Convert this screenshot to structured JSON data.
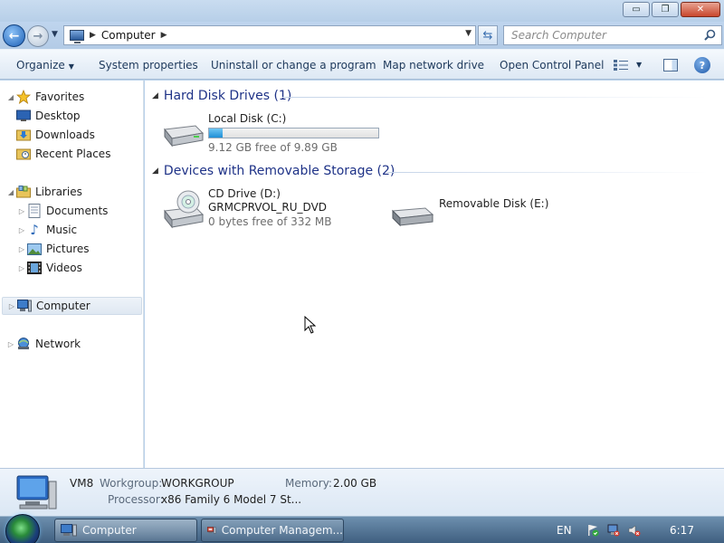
{
  "window": {
    "controls": {
      "minimize": "▭",
      "maximize": "❐",
      "close": "✕"
    }
  },
  "address": {
    "crumb": "Computer",
    "search_placeholder": "Search Computer"
  },
  "toolbar": {
    "organize": "Organize",
    "system_properties": "System properties",
    "uninstall": "Uninstall or change a program",
    "map_network_drive": "Map network drive",
    "open_control_panel": "Open Control Panel",
    "help": "?"
  },
  "nav": {
    "favorites": "Favorites",
    "desktop": "Desktop",
    "downloads": "Downloads",
    "recent_places": "Recent Places",
    "libraries": "Libraries",
    "documents": "Documents",
    "music": "Music",
    "pictures": "Pictures",
    "videos": "Videos",
    "computer": "Computer",
    "network": "Network"
  },
  "content": {
    "group_hdd": "Hard Disk Drives (1)",
    "group_removable": "Devices with Removable Storage (2)",
    "local_disk": {
      "name": "Local Disk (C:)",
      "free_text": "9.12 GB free of 9.89 GB",
      "used_fraction": 0.078
    },
    "cd_drive": {
      "name": "CD Drive (D:)",
      "label": "GRMCPRVOL_RU_DVD",
      "free_text": "0 bytes free of 332 MB"
    },
    "removable_disk": {
      "name": "Removable Disk (E:)"
    }
  },
  "details": {
    "name": "VM8",
    "workgroup_label": "Workgroup:",
    "workgroup_value": "WORKGROUP",
    "memory_label": "Memory:",
    "memory_value": "2.00 GB",
    "processor_label": "Processor:",
    "processor_value": "x86 Family 6 Model 7 St..."
  },
  "taskbar": {
    "items": [
      {
        "label": "Computer"
      },
      {
        "label": "Computer Managem..."
      }
    ],
    "language": "EN",
    "clock": "6:17"
  },
  "colors": {
    "group_header": "#1e3287",
    "capacity_fill": "#1f8fd6",
    "title_bar": "#c9dcf0",
    "taskbar": "#3f5f80"
  }
}
